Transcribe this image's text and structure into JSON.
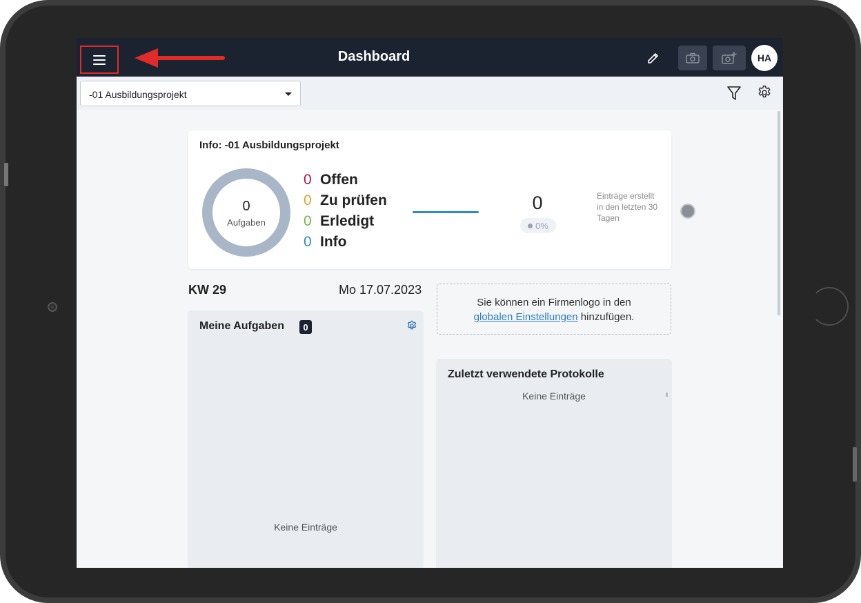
{
  "header": {
    "title": "Dashboard",
    "avatar_initials": "HA",
    "menu_icon": "hamburger-menu-icon",
    "edit_icon": "edit-icon",
    "camera_icon": "camera-icon",
    "camera_add_icon": "camera-add-icon",
    "annotation_color": "#e02b2b"
  },
  "toolbar": {
    "project_value": "-01 Ausbildungsprojekt",
    "filter_icon": "filter-icon",
    "settings_icon": "gear-icon"
  },
  "info_card": {
    "title": "Info: -01 Ausbildungsprojekt",
    "total_tasks": "0",
    "total_tasks_label": "Aufgaben",
    "statuses": [
      {
        "count": "0",
        "label": "Offen",
        "color": "#b0154a"
      },
      {
        "count": "0",
        "label": "Zu prüfen",
        "color": "#e5a321"
      },
      {
        "count": "0",
        "label": "Erledigt",
        "color": "#71b84a"
      },
      {
        "count": "0",
        "label": "Info",
        "color": "#2b8bd0"
      }
    ],
    "entries_count": "0",
    "entries_percent": "0%",
    "entries_note": "Einträge erstellt in den letzten 30 Tagen"
  },
  "week": {
    "label": "KW 29",
    "date": "Mo 17.07.2023"
  },
  "logo_hint": {
    "text_before": "Sie können ein Firmenlogo in den",
    "link": "globalen Einstellungen",
    "text_after": "hinzufügen."
  },
  "my_tasks": {
    "title": "Meine Aufgaben",
    "count": "0",
    "empty": "Keine Einträge"
  },
  "recent_protocols": {
    "title": "Zuletzt verwendete Protokolle",
    "empty": "Keine Einträge"
  }
}
